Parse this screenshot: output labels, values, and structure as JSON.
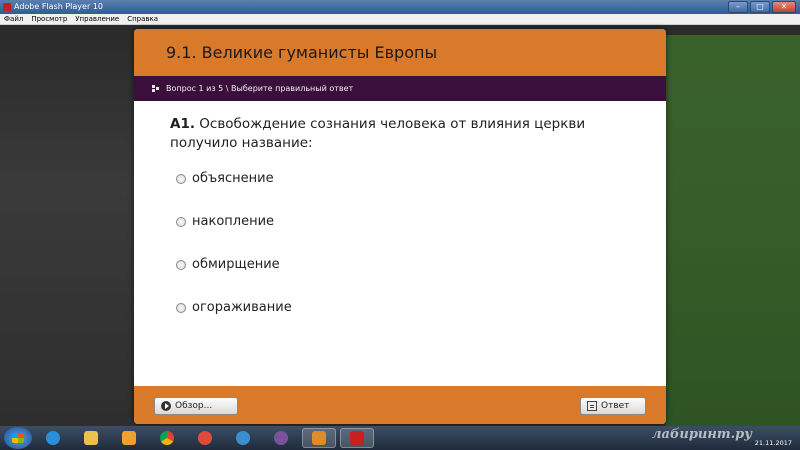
{
  "window": {
    "title": "Adobe Flash Player 10",
    "controls": {
      "minimize": "–",
      "maximize": "□",
      "close": "✕"
    }
  },
  "menu": [
    "Файл",
    "Просмотр",
    "Управление",
    "Справка"
  ],
  "quiz": {
    "title": "9.1. Великие гуманисты Европы",
    "progress": "Вопрос 1 из 5 \\ Выберите правильный ответ",
    "question_label": "А1.",
    "question_text": "Освобождение сознания человека от влияния церкви получило название:",
    "options": [
      "объяснение",
      "накопление",
      "обмирщение",
      "огораживание"
    ],
    "review_button": "Обзор...",
    "answer_button": "Ответ"
  },
  "taskbar": {
    "apps": [
      "start-orb",
      "ie-icon",
      "explorer-icon",
      "media-icon",
      "chrome-icon",
      "cake-icon",
      "globe-icon",
      "viber-icon",
      "checkbox-app-icon",
      "flash-icon"
    ],
    "watermark": "лабиринт.ру",
    "date": "21.11.2017"
  },
  "colors": {
    "accent": "#d97a2b",
    "bar": "#3b0f3b"
  }
}
